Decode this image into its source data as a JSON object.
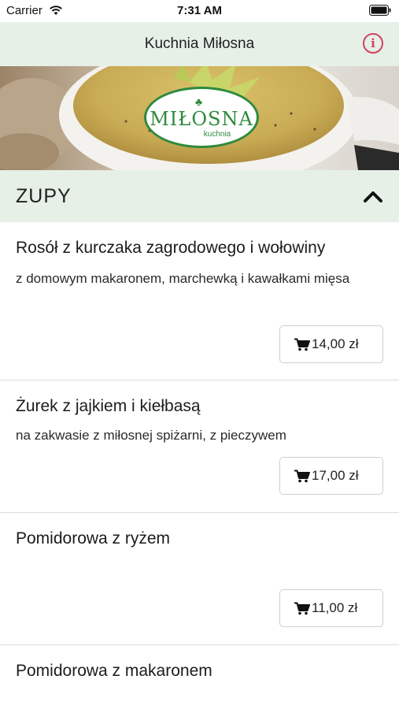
{
  "status": {
    "carrier": "Carrier",
    "time": "7:31 AM"
  },
  "nav": {
    "title": "Kuchnia Miłosna",
    "info_icon": "info-icon",
    "info_symbol": "i"
  },
  "logo": {
    "name": "MIŁOSNA",
    "sub": "kuchnia"
  },
  "section": {
    "title": "ZUPY",
    "icon": "chevron-up-icon"
  },
  "items": [
    {
      "name": "Rosół z kurczaka zagrodowego i wołowiny",
      "desc": "z domowym makaronem, marchewką i kawałkami mięsa",
      "price": "14,00 zł"
    },
    {
      "name": "Żurek z jajkiem i kiełbasą",
      "desc": "na zakwasie z miłosnej spiżarni, z pieczywem",
      "price": "17,00 zł"
    },
    {
      "name": "Pomidorowa z ryżem",
      "desc": "",
      "price": "11,00 zł"
    },
    {
      "name": "Pomidorowa z makaronem",
      "desc": "",
      "price": ""
    }
  ],
  "colors": {
    "header_bg": "#e6f0e7",
    "accent_red": "#d2435c",
    "logo_green": "#2e8a3d"
  }
}
